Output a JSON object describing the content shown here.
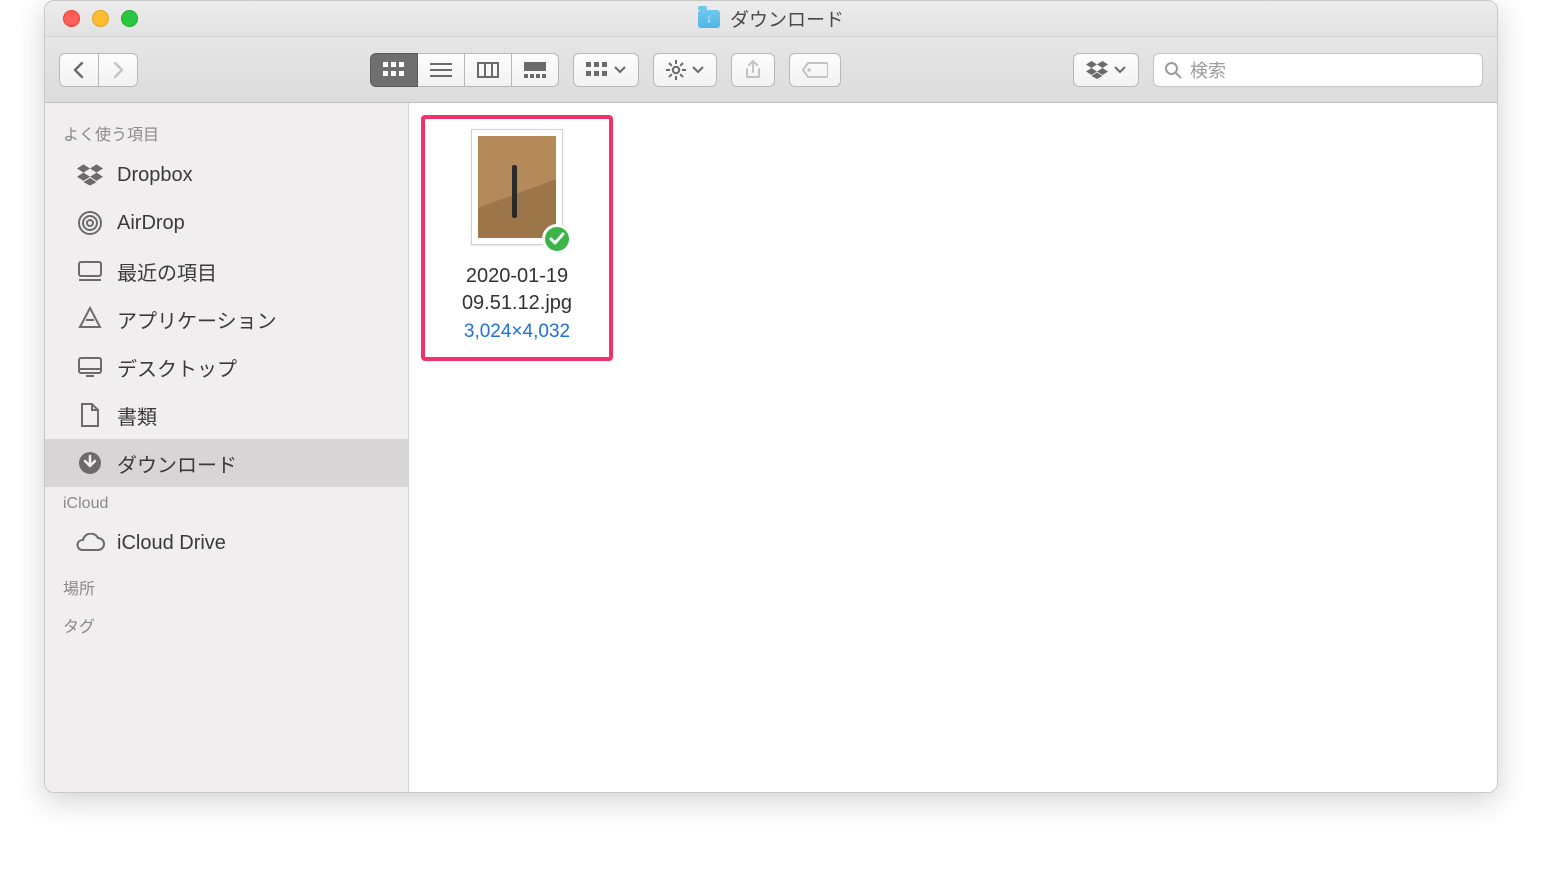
{
  "window": {
    "title": "ダウンロード"
  },
  "toolbar": {
    "search_placeholder": "検索"
  },
  "sidebar": {
    "section_favorites": "よく使う項目",
    "section_icloud": "iCloud",
    "section_locations": "場所",
    "section_tags": "タグ",
    "items": {
      "dropbox": "Dropbox",
      "airdrop": "AirDrop",
      "recents": "最近の項目",
      "applications": "アプリケーション",
      "desktop": "デスクトップ",
      "documents": "書類",
      "downloads": "ダウンロード",
      "icloud_drive": "iCloud Drive"
    }
  },
  "files": [
    {
      "name": "2020-01-19 09.51.12.jpg",
      "dimensions": "3,024×4,032"
    }
  ]
}
